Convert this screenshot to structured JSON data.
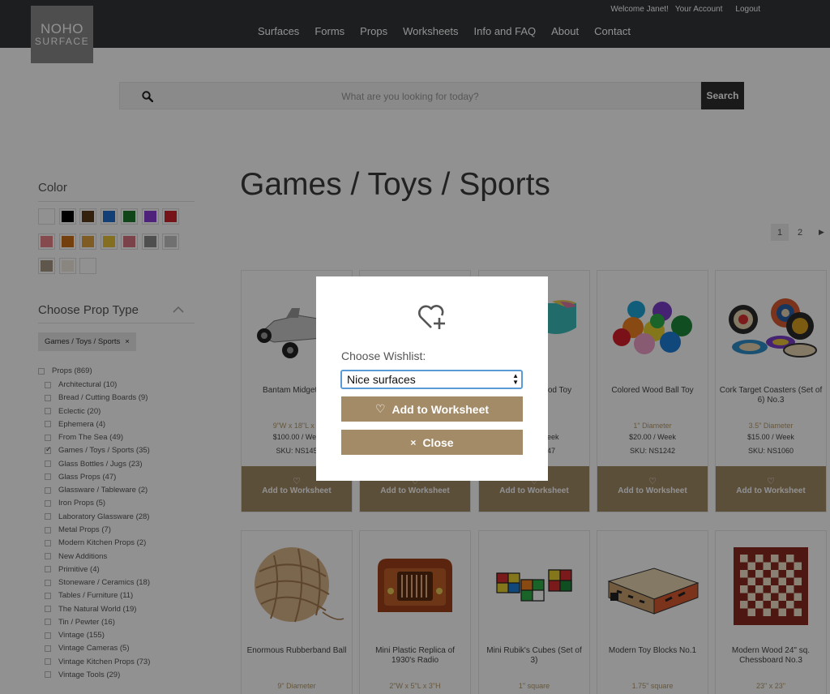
{
  "header": {
    "logo_line1": "NOHO",
    "logo_line2": "SURFACE",
    "welcome": "Welcome Janet!",
    "account": "Your Account",
    "logout": "Logout",
    "nav": [
      "Surfaces",
      "Forms",
      "Props",
      "Worksheets",
      "Info and FAQ",
      "About",
      "Contact"
    ]
  },
  "search": {
    "placeholder": "What are you looking for today?",
    "button": "Search"
  },
  "sidebar": {
    "color_heading": "Color",
    "swatches": [
      "#ffffff",
      "#000000",
      "#5a3a1a",
      "#1e6fd0",
      "#1d7a2e",
      "#8a3bd8",
      "#d0232b",
      "#e8828a",
      "#c97018",
      "#e0a33a",
      "#e8c138",
      "#d97582",
      "#8c8c8c",
      "#c6c6c6",
      "#a89a86",
      "#f1ece2",
      "#ffffff"
    ],
    "prop_type_heading": "Choose Prop Type",
    "active_filter": "Games / Toys / Sports",
    "remove_filter": "×",
    "root_facet": "Props (869)",
    "facets": [
      {
        "label": "Architectural (10)",
        "checked": false
      },
      {
        "label": "Bread / Cutting Boards (9)",
        "checked": false
      },
      {
        "label": "Eclectic (20)",
        "checked": false
      },
      {
        "label": "Ephemera (4)",
        "checked": false
      },
      {
        "label": "From The Sea (49)",
        "checked": false
      },
      {
        "label": "Games / Toys / Sports (35)",
        "checked": true
      },
      {
        "label": "Glass Bottles / Jugs (23)",
        "checked": false
      },
      {
        "label": "Glass Props (47)",
        "checked": false
      },
      {
        "label": "Glassware / Tableware (2)",
        "checked": false
      },
      {
        "label": "Iron Props (5)",
        "checked": false
      },
      {
        "label": "Laboratory Glassware (28)",
        "checked": false
      },
      {
        "label": "Metal Props (7)",
        "checked": false
      },
      {
        "label": "Modern Kitchen Props (2)",
        "checked": false
      },
      {
        "label": "New Additions",
        "checked": false
      },
      {
        "label": "Primitive (4)",
        "checked": false
      },
      {
        "label": "Stoneware / Ceramics (18)",
        "checked": false
      },
      {
        "label": "Tables / Furniture (11)",
        "checked": false
      },
      {
        "label": "The Natural World (19)",
        "checked": false
      },
      {
        "label": "Tin / Pewter (16)",
        "checked": false
      },
      {
        "label": "Vintage (155)",
        "checked": false
      },
      {
        "label": "Vintage Cameras (5)",
        "checked": false
      },
      {
        "label": "Vintage Kitchen Props (73)",
        "checked": false
      },
      {
        "label": "Vintage Tools (29)",
        "checked": false
      }
    ]
  },
  "main": {
    "title": "Games / Toys / Sports",
    "pages": [
      "1",
      "2"
    ],
    "next": "▶",
    "add_label": "Add to Worksheet",
    "heart_glyph": "♡",
    "products_row1": [
      {
        "name": "Bantam Midget Mo",
        "dim": "9\"W x 18\"L x 7",
        "price": "$100.00 / Wee",
        "sku": "SKU: NS145"
      },
      {
        "name": "",
        "dim": "",
        "price": "",
        "sku": ""
      },
      {
        "name": "Wood Toy",
        "name2": "t",
        "dim": "",
        "price": "eek",
        "sku": "47"
      },
      {
        "name": "Colored Wood Ball Toy",
        "dim": "1\" Diameter",
        "price": "$20.00 / Week",
        "sku": "SKU: NS1242"
      },
      {
        "name": "Cork Target Coasters (Set of 6) No.3",
        "dim": "3.5\" Diameter",
        "price": "$15.00 / Week",
        "sku": "SKU: NS1060"
      }
    ],
    "products_row2": [
      {
        "name": "Enormous Rubberband Ball",
        "dim": "9\" Diameter"
      },
      {
        "name": "Mini Plastic Replica of 1930's Radio",
        "dim": "2\"W x 5\"L x 3\"H"
      },
      {
        "name": "Mini Rubik's Cubes (Set of 3)",
        "dim": "1\" square"
      },
      {
        "name": "Modern Toy Blocks No.1",
        "dim": "1.75\" square"
      },
      {
        "name": "Modern Wood 24\" sq. Chessboard No.3",
        "dim": "23\" x 23\""
      }
    ]
  },
  "modal": {
    "label": "Choose Wishlist:",
    "selected": "Nice surfaces",
    "add_button": "Add to Worksheet",
    "close_button": "Close",
    "close_glyph": "×",
    "heart_glyph": "♡"
  }
}
